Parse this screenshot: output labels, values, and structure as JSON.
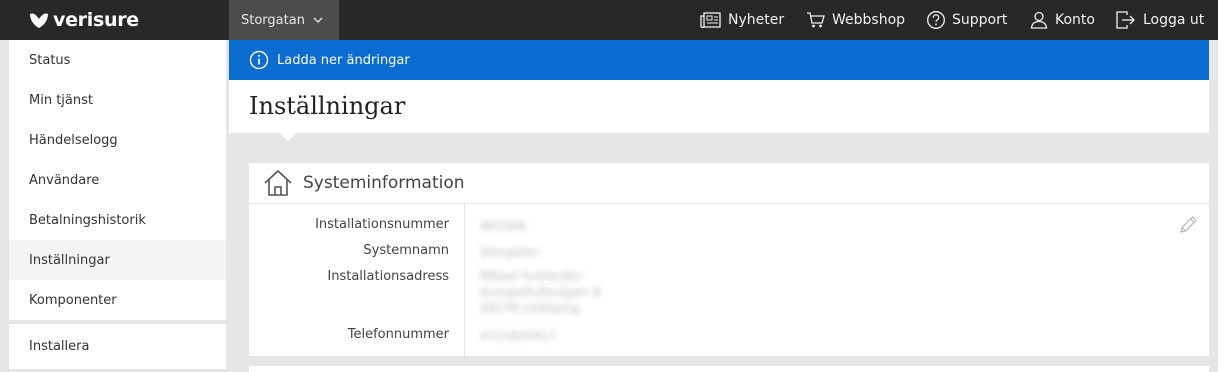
{
  "header": {
    "logo_text": "verisure",
    "site_selector": "Storgatan",
    "nav": [
      {
        "label": "Nyheter",
        "icon": "newspaper-icon"
      },
      {
        "label": "Webbshop",
        "icon": "cart-icon"
      },
      {
        "label": "Support",
        "icon": "question-circle-icon"
      },
      {
        "label": "Konto",
        "icon": "user-icon"
      },
      {
        "label": "Logga ut",
        "icon": "logout-icon"
      }
    ]
  },
  "sidebar": {
    "items": [
      {
        "label": "Status"
      },
      {
        "label": "Min tjänst"
      },
      {
        "label": "Händelselogg"
      },
      {
        "label": "Användare"
      },
      {
        "label": "Betalningshistorik"
      },
      {
        "label": "Inställningar",
        "active": true
      },
      {
        "label": "Komponenter"
      }
    ],
    "secondary_items": [
      {
        "label": "Installera"
      }
    ]
  },
  "banner": {
    "text": "Ladda ner ändringar",
    "icon": "info-icon",
    "color": "#0a6bd1"
  },
  "page": {
    "title": "Inställningar"
  },
  "system_info": {
    "heading": "Systeminformation",
    "icon": "house-icon",
    "fields": {
      "installation_number": {
        "label": "Installationsnummer",
        "value": "461509"
      },
      "system_name": {
        "label": "Systemnamn",
        "value": "Storgatan"
      },
      "address": {
        "label": "Installationsadress",
        "lines": [
          "Mikael Svelander",
          "Gumpeltullsvägen 8",
          "58278 Linköping"
        ]
      },
      "phone": {
        "label": "Telefonnummer",
        "value": "0721829417"
      }
    }
  },
  "colors": {
    "topbar": "#26282a",
    "accent": "#0a6bd1",
    "background": "#e6e6e6"
  }
}
